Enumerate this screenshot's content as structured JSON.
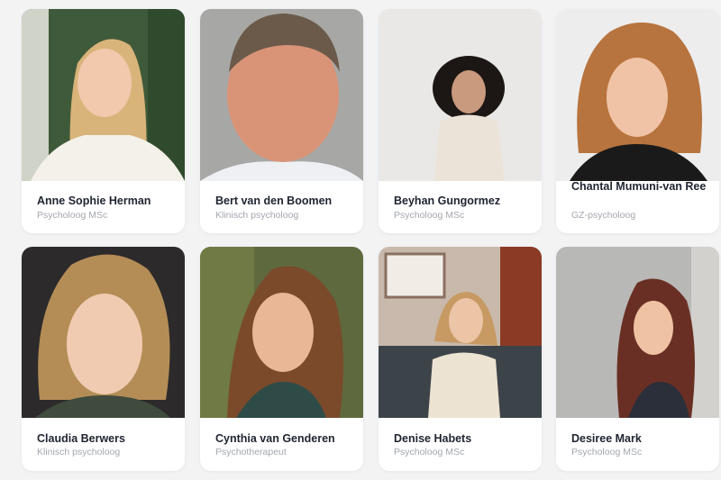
{
  "team": [
    {
      "name": "Anne Sophie Herman",
      "role": "Psycholoog MSc"
    },
    {
      "name": "Bert van den Boomen",
      "role": "Klinisch psycholoog"
    },
    {
      "name": "Beyhan Gungormez",
      "role": "Psycholoog MSc"
    },
    {
      "name": "Chantal Mumuni-van Ree",
      "role": "GZ-psycholoog"
    },
    {
      "name": "Claudia Berwers",
      "role": "Klinisch psycholoog"
    },
    {
      "name": "Cynthia van Genderen",
      "role": "Psychotherapeut"
    },
    {
      "name": "Denise Habets",
      "role": "Psycholoog MSc"
    },
    {
      "name": "Desiree Mark",
      "role": "Psycholoog MSc"
    }
  ],
  "colors": {
    "page_background": "#f3f3f4",
    "card_background": "#ffffff",
    "name_text": "#1f2430",
    "role_text": "#a3a7ae"
  }
}
